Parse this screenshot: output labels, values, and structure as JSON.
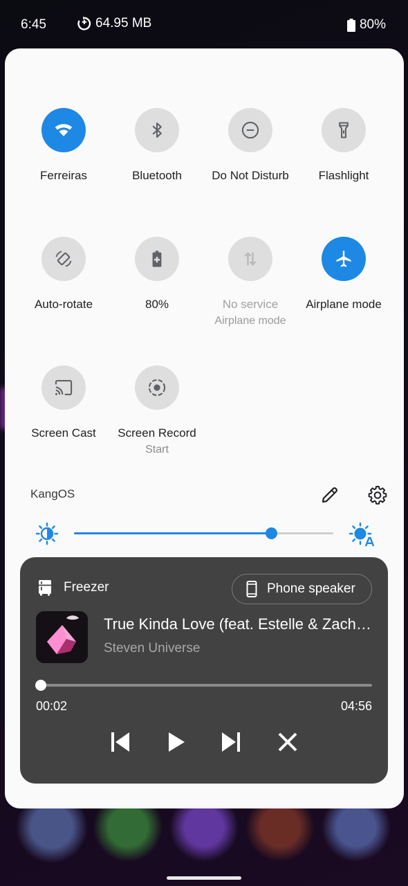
{
  "status_bar": {
    "time": "6:45",
    "data_usage": "64.95 MB",
    "battery": "80%"
  },
  "tiles": [
    {
      "label": "Ferreiras",
      "sub": "",
      "state": "on",
      "icon": "wifi-icon"
    },
    {
      "label": "Bluetooth",
      "sub": "",
      "state": "off",
      "icon": "bluetooth-icon"
    },
    {
      "label": "Do Not Disturb",
      "sub": "",
      "state": "off",
      "icon": "do-not-disturb-icon"
    },
    {
      "label": "Flashlight",
      "sub": "",
      "state": "off",
      "icon": "flashlight-icon"
    },
    {
      "label": "Auto-rotate",
      "sub": "",
      "state": "off",
      "icon": "auto-rotate-icon"
    },
    {
      "label": "80%",
      "sub": "",
      "state": "off",
      "icon": "battery-saver-icon"
    },
    {
      "label": "No service",
      "sub": "Airplane mode",
      "state": "unavailable",
      "icon": "mobile-data-icon"
    },
    {
      "label": "Airplane mode",
      "sub": "",
      "state": "on",
      "icon": "airplane-icon"
    },
    {
      "label": "Screen Cast",
      "sub": "",
      "state": "off",
      "icon": "cast-icon"
    },
    {
      "label": "Screen Record",
      "sub": "Start",
      "state": "off",
      "icon": "screen-record-icon"
    }
  ],
  "footer": {
    "build_label": "KangOS"
  },
  "brightness": {
    "level": 0.76
  },
  "media": {
    "app_name": "Freezer",
    "output_device": "Phone speaker",
    "title": "True Kinda Love (feat. Estelle & Zach Callison)",
    "artist": "Steven Universe",
    "elapsed": "00:02",
    "duration": "04:56",
    "progress": 0.007
  },
  "colors": {
    "accent": "#1e88e5",
    "panel_bg": "#fafafa",
    "media_card_bg": "#424242",
    "tile_off_bg": "#dedede"
  }
}
